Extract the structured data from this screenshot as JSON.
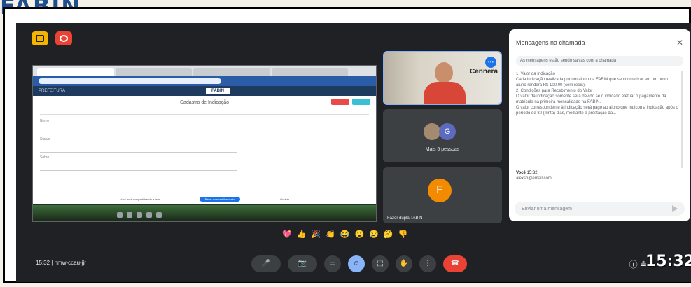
{
  "brand": "FABIN",
  "top_buttons": [
    {
      "name": "folder-button",
      "icon": "folder-icon"
    },
    {
      "name": "record-button",
      "icon": "record-icon"
    }
  ],
  "shared_screen": {
    "tabs": [
      "",
      "",
      "",
      ""
    ],
    "app_name": "PREFEITURA",
    "app_logo": "FABIN",
    "form_title": "Cadastro de Indicação",
    "fields": [
      "Nome",
      "Status",
      "Sobre"
    ],
    "share_notice": "Você está compartilhando a tela",
    "share_stop_label": "Parar compartilhamento",
    "share_hide_label": "Ocultar"
  },
  "participants": {
    "camera": {
      "wall_text": "Cennera",
      "name_label": "",
      "talking_icon": "talking-icon"
    },
    "more": {
      "label": "Mais 5 pessoas",
      "letter": "G"
    },
    "self": {
      "letter": "F",
      "label": "Fazer dupla TABIN"
    }
  },
  "chat": {
    "title": "Mensagens na chamada",
    "close": "✕",
    "notice": "As mensagens estão sendo salvas com a chamada",
    "body": "1. Valor da Indicação\n    Cada indicação realizada por um aluno da FABIN que se concretizar em um novo aluno renderá R$ 100,00 (cem reais).\n2. Condições para Recebimento do Valor\n    O valor da indicação somente será devido se o indicado efetuar o pagamento da matrícula na primeira mensalidade na FABIN.\n    O valor correspondente à indicação será pago ao aluno que indicou a indicação após o período de 30 (trinta) dias, mediante a prestação da...",
    "sender": "Você",
    "sender_time": "15:32",
    "last_message": "alexsb@email.com",
    "input_placeholder": "Enviar uma mensagem"
  },
  "reactions": [
    "💖",
    "👍",
    "🎉",
    "👏",
    "😂",
    "😮",
    "😢",
    "🤔",
    "👎"
  ],
  "bottom": {
    "clock": "15:32",
    "meeting_code": "nmw-ccau-jjr",
    "controls": [
      "mic",
      "camera",
      "captions",
      "emoji",
      "present",
      "raise-hand",
      "more",
      "hangup"
    ],
    "right_info": "ⓘ  ≗",
    "big_time": "15:32"
  }
}
